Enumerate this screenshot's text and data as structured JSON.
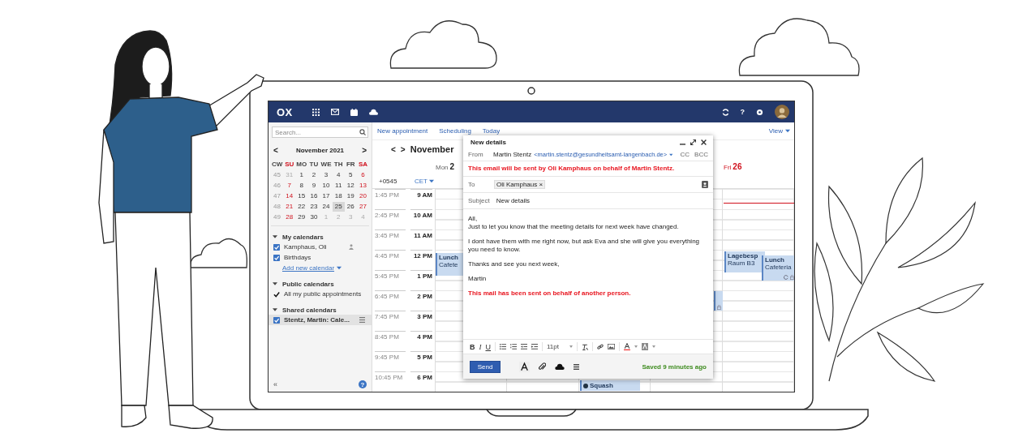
{
  "topbar": {
    "logo": "OX",
    "help": "?"
  },
  "sidebar": {
    "search": {
      "placeholder": "Search..."
    },
    "mini_calendar": {
      "prev": "<",
      "next": ">",
      "month": "November 2021",
      "headers": [
        {
          "label": "CW",
          "weekend": false
        },
        {
          "label": "SU",
          "weekend": true
        },
        {
          "label": "MO",
          "weekend": false
        },
        {
          "label": "TU",
          "weekend": false
        },
        {
          "label": "WE",
          "weekend": false
        },
        {
          "label": "TH",
          "weekend": false
        },
        {
          "label": "FR",
          "weekend": false
        },
        {
          "label": "SA",
          "weekend": true
        }
      ],
      "weeks": [
        {
          "cw": "45",
          "days": [
            {
              "day": "31",
              "muted": true,
              "selected": false
            },
            {
              "day": "1",
              "muted": false,
              "selected": false
            },
            {
              "day": "2",
              "muted": false,
              "selected": false
            },
            {
              "day": "3",
              "muted": false,
              "selected": false
            },
            {
              "day": "4",
              "muted": false,
              "selected": false
            },
            {
              "day": "5",
              "muted": false,
              "selected": false
            },
            {
              "day": "6",
              "muted": false,
              "selected": false
            }
          ]
        },
        {
          "cw": "46",
          "days": [
            {
              "day": "7",
              "muted": false,
              "selected": false
            },
            {
              "day": "8",
              "muted": false,
              "selected": false
            },
            {
              "day": "9",
              "muted": false,
              "selected": false
            },
            {
              "day": "10",
              "muted": false,
              "selected": false
            },
            {
              "day": "11",
              "muted": false,
              "selected": false
            },
            {
              "day": "12",
              "muted": false,
              "selected": false
            },
            {
              "day": "13",
              "muted": false,
              "selected": false
            }
          ]
        },
        {
          "cw": "47",
          "days": [
            {
              "day": "14",
              "muted": false,
              "selected": false
            },
            {
              "day": "15",
              "muted": false,
              "selected": false
            },
            {
              "day": "16",
              "muted": false,
              "selected": false
            },
            {
              "day": "17",
              "muted": false,
              "selected": false
            },
            {
              "day": "18",
              "muted": false,
              "selected": false
            },
            {
              "day": "19",
              "muted": false,
              "selected": false
            },
            {
              "day": "20",
              "muted": false,
              "selected": false
            }
          ]
        },
        {
          "cw": "48",
          "days": [
            {
              "day": "21",
              "muted": false,
              "selected": false
            },
            {
              "day": "22",
              "muted": false,
              "selected": false
            },
            {
              "day": "23",
              "muted": false,
              "selected": false
            },
            {
              "day": "24",
              "muted": false,
              "selected": false
            },
            {
              "day": "25",
              "muted": false,
              "selected": true
            },
            {
              "day": "26",
              "muted": false,
              "selected": false
            },
            {
              "day": "27",
              "muted": false,
              "selected": false
            }
          ]
        },
        {
          "cw": "49",
          "days": [
            {
              "day": "28",
              "muted": false,
              "selected": false
            },
            {
              "day": "29",
              "muted": false,
              "selected": false
            },
            {
              "day": "30",
              "muted": false,
              "selected": false
            },
            {
              "day": "1",
              "muted": true,
              "selected": false
            },
            {
              "day": "2",
              "muted": true,
              "selected": false
            },
            {
              "day": "3",
              "muted": true,
              "selected": false
            },
            {
              "day": "4",
              "muted": true,
              "selected": false
            }
          ]
        }
      ]
    },
    "sections": [
      {
        "title": "My calendars",
        "expanded": true,
        "items": [
          {
            "label": "Kamphaus, Oli",
            "kind": "owner",
            "checked": true,
            "selected": false
          },
          {
            "label": "Birthdays",
            "kind": "plain",
            "checked": true,
            "selected": false
          }
        ],
        "link": "Add new calendar"
      },
      {
        "title": "Public calendars",
        "expanded": true,
        "items": [
          {
            "label": "All my public appointments",
            "kind": "tick",
            "checked": true,
            "selected": false
          }
        ]
      },
      {
        "title": "Shared calendars",
        "expanded": true,
        "items": [
          {
            "label": "Stentz, Martin: Cale...",
            "kind": "shared",
            "checked": true,
            "selected": true
          }
        ]
      }
    ],
    "collapse": "«",
    "help": "?"
  },
  "toolbar": {
    "items": [
      "New appointment",
      "Scheduling",
      "Today"
    ],
    "view": "View"
  },
  "calendar": {
    "prev": "<",
    "next": ">",
    "title": "November",
    "days": [
      {
        "name": "Mon",
        "date": "2",
        "today": false
      },
      {
        "name": "Fri",
        "date": "26",
        "today": true
      }
    ],
    "timezones": [
      "+0545",
      "CET"
    ],
    "rows": [
      {
        "local": "1:45 PM",
        "hour": "9 AM"
      },
      {
        "local": "2:45 PM",
        "hour": "10 AM"
      },
      {
        "local": "3:45 PM",
        "hour": "11 AM"
      },
      {
        "local": "4:45 PM",
        "hour": "12 PM"
      },
      {
        "local": "5:45 PM",
        "hour": "1 PM"
      },
      {
        "local": "6:45 PM",
        "hour": "2 PM"
      },
      {
        "local": "7:45 PM",
        "hour": "3 PM"
      },
      {
        "local": "8:45 PM",
        "hour": "4 PM"
      },
      {
        "local": "9:45 PM",
        "hour": "5 PM"
      },
      {
        "local": "10:45 PM",
        "hour": "6 PM"
      }
    ],
    "events": [
      {
        "kind": "appointment",
        "title": "Lunch",
        "location": "Cafete"
      },
      {
        "kind": "appointment"
      },
      {
        "kind": "appointment",
        "title": "Lagebesp",
        "location": "Raum B3"
      },
      {
        "kind": "appointment",
        "title": "Lunch",
        "location": "Cafeteria"
      },
      {
        "kind": "appointment",
        "title": "Squash"
      }
    ]
  },
  "compose": {
    "title": "New details",
    "from": {
      "label": "From",
      "name": "Martin Stentz",
      "address": "<martin.stentz@gesundheitsamt-langenbach.de>",
      "cc": "CC",
      "bcc": "BCC"
    },
    "warning": "This email will be sent by Oli Kamphaus on behalf of Martin Stentz.",
    "to": {
      "label": "To",
      "recipients": [
        {
          "name": "Oli Kamphaus",
          "remove": "×"
        }
      ]
    },
    "subject": {
      "label": "Subject",
      "value": "New details"
    },
    "body": [
      [
        "All,",
        "Just to let you know that the meeting details for next week have changed."
      ],
      [
        "I dont have them with me right now, but ask Eva and she will give you everything you need to know."
      ],
      [
        "Thanks and see you next week,"
      ],
      [
        "Martin"
      ]
    ],
    "notice": "This mail has been sent on behalf of another person.",
    "format": {
      "bold": "B",
      "italic": "I",
      "underline": "U",
      "size": "11pt"
    },
    "send": "Send",
    "status": "Saved 9 minutes ago"
  }
}
